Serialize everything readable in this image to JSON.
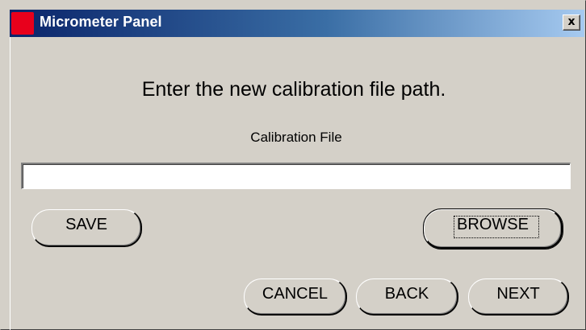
{
  "window": {
    "title": "Micrometer Panel",
    "close_glyph": "x",
    "app_icon": "crescent-logo-icon"
  },
  "main": {
    "prompt": "Enter the new calibration file path.",
    "field_label": "Calibration File",
    "field_value": ""
  },
  "buttons": {
    "save": "SAVE",
    "browse": "BROWSE",
    "cancel": "CANCEL",
    "back": "BACK",
    "next": "NEXT"
  },
  "colors": {
    "face": "#d4d0c8",
    "title_start": "#0a246a",
    "title_end": "#a6caf0",
    "icon_red": "#e8001c"
  }
}
